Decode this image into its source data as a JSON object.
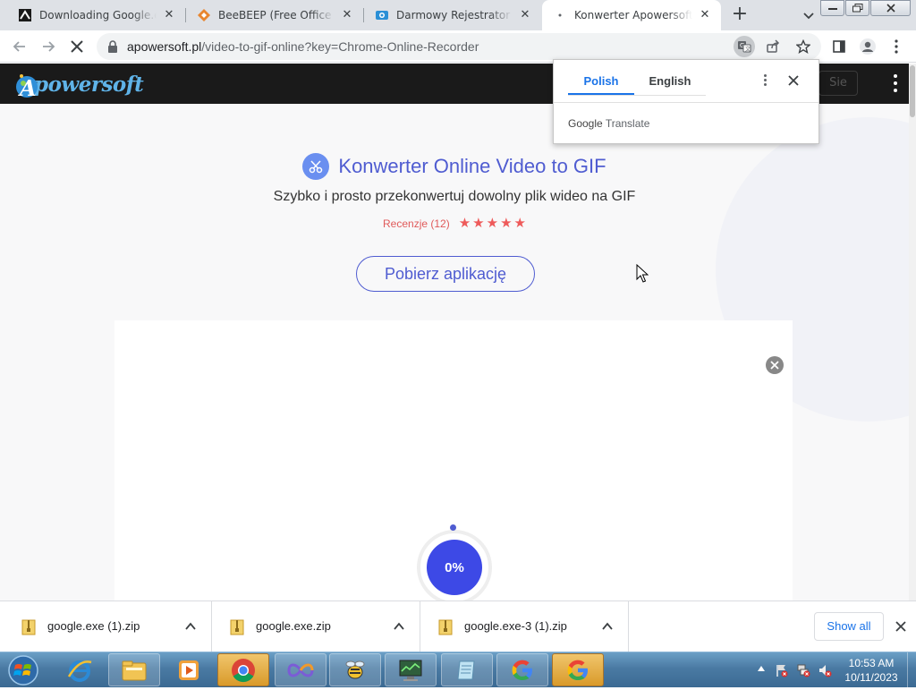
{
  "tabs": [
    {
      "title": "Downloading Google.exe",
      "icon": "download-favicon-icon"
    },
    {
      "title": "BeeBEEP (Free Office Messenger)",
      "icon": "beebeep-favicon-icon"
    },
    {
      "title": "Darmowy Rejestrator Ekranu",
      "icon": "recorder-favicon-icon"
    },
    {
      "title": "Konwerter Apowersoft Online",
      "icon": "loading-favicon-icon",
      "active": true
    }
  ],
  "toolbar": {
    "url_host": "apowersoft.pl",
    "url_path": "/video-to-gif-online?key=Chrome-Online-Recorder"
  },
  "site": {
    "logo_text": "powersoft",
    "logo_letter": "A",
    "signin_label": "Sie",
    "title": "Konwerter Online Video to GIF",
    "subtitle": "Szybko i prosto przekonwertuj dowolny plik wideo na GIF",
    "reviews_label": "Recenzje (12)",
    "rating": 5,
    "rating_max": 5,
    "download_button": "Pobierz aplikację",
    "progress_label": "0%",
    "progress_value": 0
  },
  "translate_popup": {
    "lang_source": "Polish",
    "lang_target": "English",
    "brand_google": "Google",
    "brand_translate": "Translate"
  },
  "downloads": {
    "items": [
      {
        "name": "google.exe (1).zip"
      },
      {
        "name": "google.exe.zip"
      },
      {
        "name": "google.exe-3 (1).zip"
      }
    ],
    "show_all": "Show all"
  },
  "taskbar": {
    "apps": [
      "internet-explorer-icon",
      "file-explorer-icon",
      "media-player-icon",
      "chrome-icon",
      "app-infinity-icon",
      "beebeep-icon",
      "monitor-app-icon",
      "notepad-icon",
      "google-app-icon",
      "google-app-icon-2"
    ],
    "time": "10:53 AM",
    "date": "10/11/2023"
  },
  "colors": {
    "brand": "#4f5cd1",
    "stars": "#ee5a5a",
    "progress": "#3d49e6",
    "link": "#1a73e8"
  }
}
